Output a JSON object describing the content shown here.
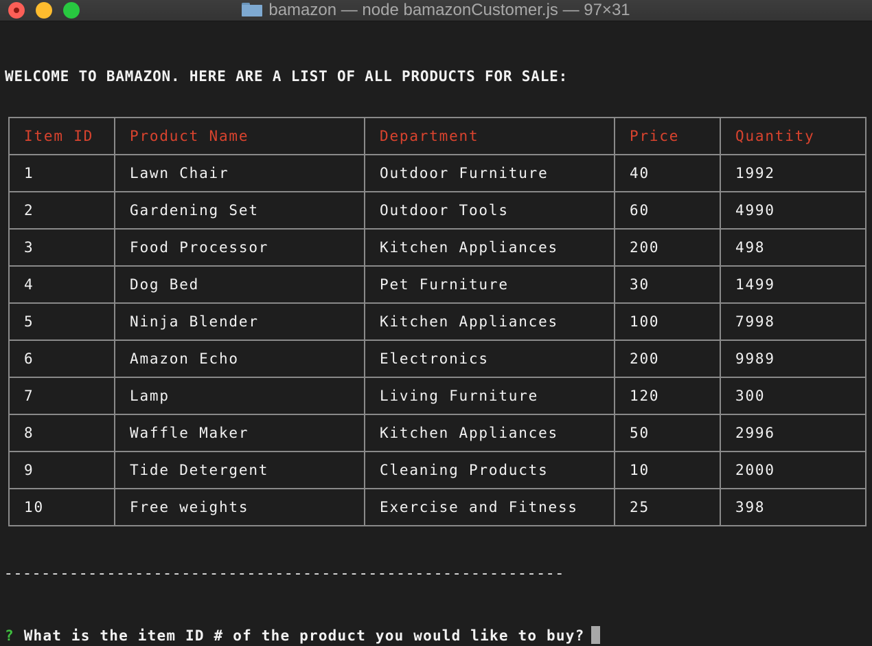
{
  "window": {
    "title": "bamazon — node bamazonCustomer.js — 97×31"
  },
  "terminal": {
    "welcome": "WELCOME TO BAMAZON. HERE ARE A LIST OF ALL PRODUCTS FOR SALE:",
    "columns": [
      "Item ID",
      "Product Name",
      "Department",
      "Price",
      "Quantity"
    ],
    "rows": [
      [
        "1",
        "Lawn Chair",
        "Outdoor Furniture",
        "40",
        "1992"
      ],
      [
        "2",
        "Gardening Set",
        "Outdoor Tools",
        "60",
        "4990"
      ],
      [
        "3",
        "Food Processor",
        "Kitchen Appliances",
        "200",
        "498"
      ],
      [
        "4",
        "Dog Bed",
        "Pet Furniture",
        "30",
        "1499"
      ],
      [
        "5",
        "Ninja Blender",
        "Kitchen Appliances",
        "100",
        "7998"
      ],
      [
        "6",
        "Amazon Echo",
        "Electronics",
        "200",
        "9989"
      ],
      [
        "7",
        "Lamp",
        "Living Furniture",
        "120",
        "300"
      ],
      [
        "8",
        "Waffle Maker",
        "Kitchen Appliances",
        "50",
        "2996"
      ],
      [
        "9",
        "Tide Detergent",
        "Cleaning Products",
        "10",
        "2000"
      ],
      [
        "10",
        "Free weights",
        "Exercise and Fitness",
        "25",
        "398"
      ]
    ],
    "divider": "------------------------------------------------------------",
    "prompt_mark": "?",
    "prompt": "What is the item ID # of the product you would like to buy?"
  },
  "colors": {
    "background": "#1e1e1e",
    "header_text": "#d9432e",
    "prompt_mark": "#3fbf3f",
    "text": "#f2f2f2"
  }
}
